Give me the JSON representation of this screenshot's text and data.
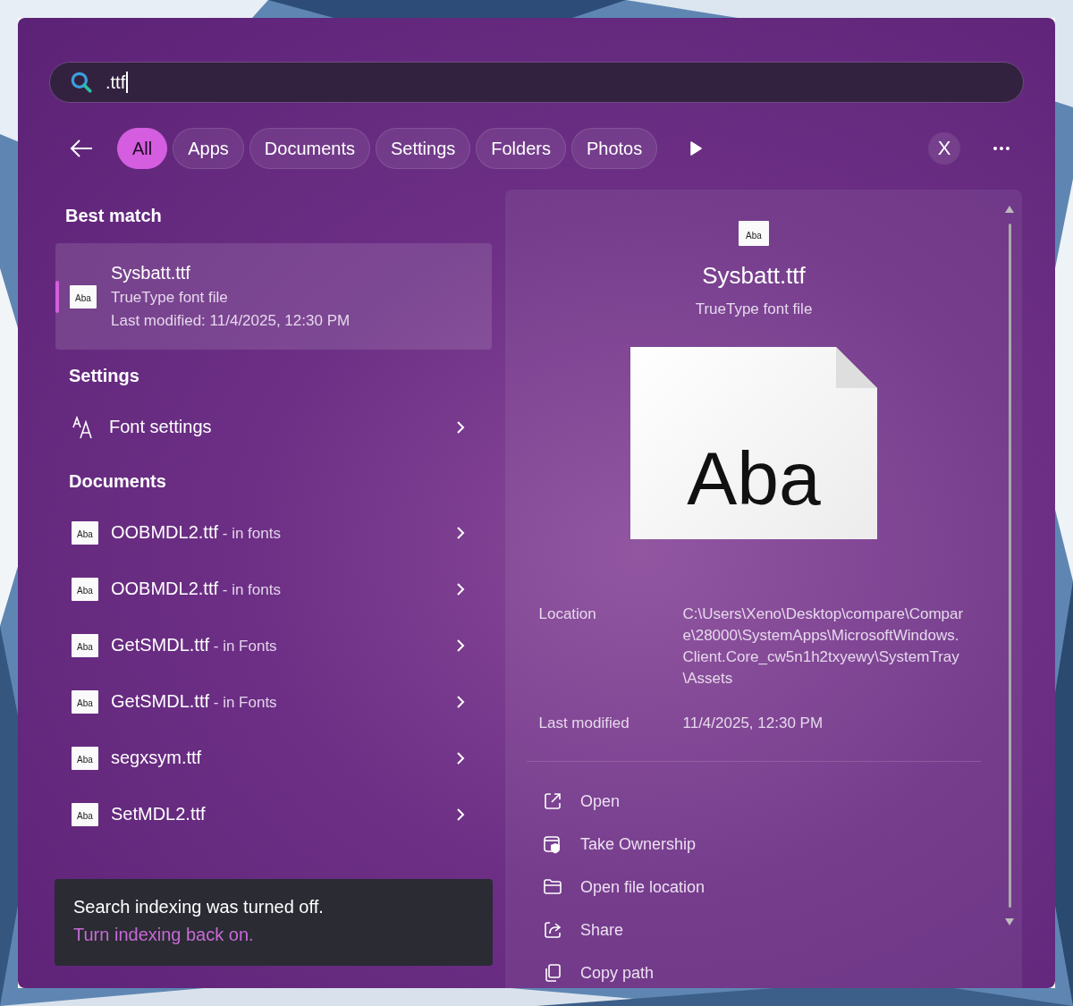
{
  "search": {
    "value": ".ttf"
  },
  "filters": [
    {
      "label": "All",
      "selected": true
    },
    {
      "label": "Apps",
      "selected": false
    },
    {
      "label": "Documents",
      "selected": false
    },
    {
      "label": "Settings",
      "selected": false
    },
    {
      "label": "Folders",
      "selected": false
    },
    {
      "label": "Photos",
      "selected": false
    }
  ],
  "account": {
    "label": "X"
  },
  "best_match": {
    "heading": "Best match",
    "name": "Sysbatt.ttf",
    "type": "TrueType font file",
    "modified": "Last modified: 11/4/2025, 12:30 PM",
    "icon_label": "Aba",
    "selected": true
  },
  "settings": {
    "heading": "Settings",
    "items": [
      {
        "name": "Font settings"
      }
    ]
  },
  "documents": {
    "heading": "Documents",
    "items": [
      {
        "name": "OOBMDL2.ttf",
        "location": " - in fonts",
        "icon_label": "Aba"
      },
      {
        "name": "OOBMDL2.ttf",
        "location": " - in fonts",
        "icon_label": "Aba"
      },
      {
        "name": "GetSMDL.ttf",
        "location": " - in Fonts",
        "icon_label": "Aba"
      },
      {
        "name": "GetSMDL.ttf",
        "location": " - in Fonts",
        "icon_label": "Aba"
      },
      {
        "name": "segxsym.ttf",
        "icon_label": "Aba"
      },
      {
        "name": "SetMDL2.ttf",
        "icon_label": "Aba"
      }
    ]
  },
  "toast": {
    "message": "Search indexing was turned off.",
    "link": "Turn indexing back on."
  },
  "preview": {
    "icon_label": "Aba",
    "title": "Sysbatt.ttf",
    "subtitle": "TrueType font file",
    "preview_text": "Aba",
    "details": [
      {
        "label": "Location",
        "value": "C:\\Users\\Xeno\\Desktop\\compare\\Compare\\28000\\SystemApps\\MicrosoftWindows.Client.Core_cw5n1h2txyewy\\SystemTray\\Assets"
      },
      {
        "label": "Last modified",
        "value": "11/4/2025, 12:30 PM"
      }
    ],
    "actions": [
      {
        "kind": "open",
        "label": "Open"
      },
      {
        "kind": "ownership",
        "label": "Take Ownership"
      },
      {
        "kind": "folder",
        "label": "Open file location"
      },
      {
        "kind": "share",
        "label": "Share"
      },
      {
        "kind": "copy",
        "label": "Copy path"
      }
    ]
  }
}
